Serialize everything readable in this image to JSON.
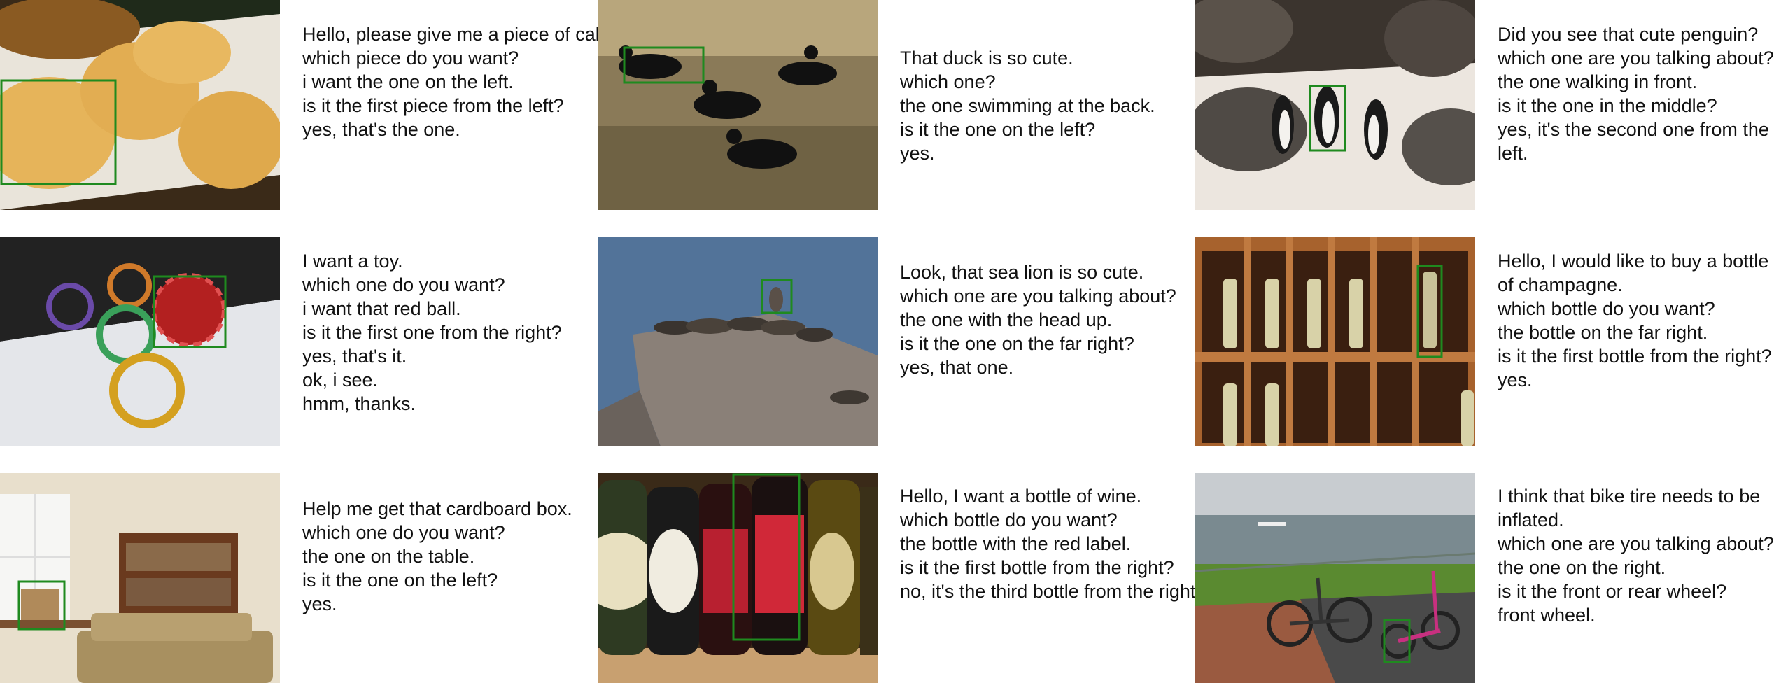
{
  "panels": [
    {
      "image": "pancakes-on-plate",
      "dialogue": [
        "Hello, please give me a piece of cake.",
        "which piece do you want?",
        "i want the one on the left.",
        "is it the first piece from the left?",
        "yes, that's the one."
      ]
    },
    {
      "image": "ducks-silhouette-on-water",
      "dialogue": [
        "That duck is so cute.",
        "which one?",
        "the one swimming at the back.",
        "is it the one on the left?",
        "yes."
      ]
    },
    {
      "image": "penguins-on-beach",
      "dialogue": [
        "Did you see that cute penguin?",
        "which one are you talking about?",
        "the one walking in front.",
        "is it the one in the middle?",
        "yes, it's the second one from the left."
      ]
    },
    {
      "image": "colorful-paper-balls",
      "dialogue": [
        "I want a toy.",
        "which one do you want?",
        "i want that red ball.",
        "is it the first one from the right?",
        "yes, that's it.",
        "ok, i see.",
        "hmm, thanks."
      ]
    },
    {
      "image": "sea-lions-on-rock",
      "dialogue": [
        "Look, that sea lion is so cute.",
        "which one are you talking about?",
        "the one with the head up.",
        "is it the one on the far right?",
        "yes, that one."
      ]
    },
    {
      "image": "wine-rack-bottles",
      "dialogue": [
        "Hello, I would like to buy a bottle of champagne.",
        "which bottle do you want?",
        "the bottle on the far right.",
        "is it the first bottle from the right?",
        "yes."
      ]
    },
    {
      "image": "living-room-with-box",
      "dialogue": [
        "Help me get that cardboard box.",
        "which one do you want?",
        "the one on the table.",
        "is it the one on the left?",
        "yes."
      ]
    },
    {
      "image": "beer-bottles-closeup",
      "dialogue": [
        "Hello, I want a bottle of wine.",
        "which bottle do you want?",
        "the bottle with the red label.",
        "is it the first bottle from the right?",
        "no, it's the third bottle from the right."
      ]
    },
    {
      "image": "folding-bikes-by-river",
      "dialogue": [
        "I think that bike tire needs to be inflated.",
        "which one are you talking about?",
        "the one on the right.",
        "is it the front or rear wheel?",
        "front wheel."
      ]
    }
  ],
  "colors": {
    "box": "#1f8a1f",
    "text": "#111111"
  }
}
